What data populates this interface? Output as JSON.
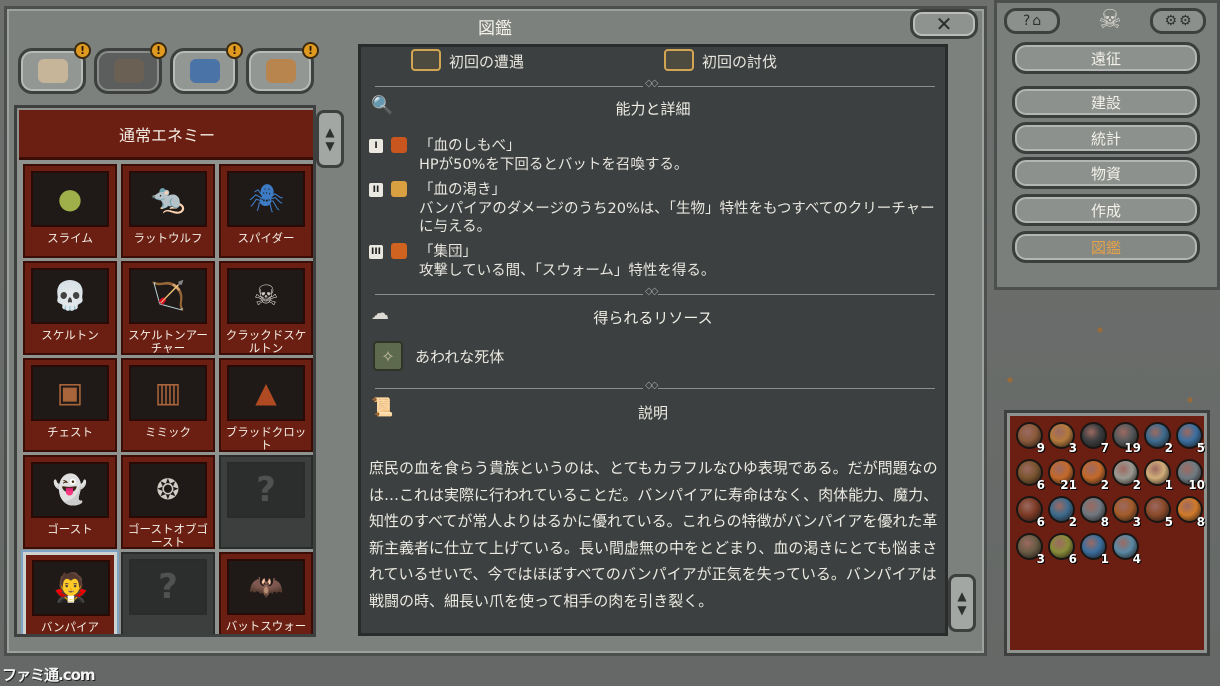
{
  "window": {
    "title": "図鑑"
  },
  "tabs": [
    {
      "name": "map",
      "alert": "!",
      "color": "#c7b59a"
    },
    {
      "name": "enemy",
      "alert": "!",
      "color": "#6b6054",
      "active": true
    },
    {
      "name": "items",
      "alert": "!",
      "color": "#4a74a8"
    },
    {
      "name": "buildings",
      "alert": "!",
      "color": "#b9854f"
    }
  ],
  "enemy_list": {
    "header": "通常エネミー",
    "enemies": [
      {
        "name": "スライム",
        "sprite": "●",
        "color": "#9fb04a"
      },
      {
        "name": "ラットウルフ",
        "sprite": "🐀",
        "color": "#a85c3a"
      },
      {
        "name": "スパイダー",
        "sprite": "🕷",
        "color": "#3d7bc4"
      },
      {
        "name": "スケルトン",
        "sprite": "💀",
        "color": "#d8d6cc"
      },
      {
        "name": "スケルトンアーチャー",
        "sprite": "🏹",
        "color": "#d8d6cc"
      },
      {
        "name": "クラックドスケルトン",
        "sprite": "☠",
        "color": "#c9c7be"
      },
      {
        "name": "チェスト",
        "sprite": "▣",
        "color": "#a8643a"
      },
      {
        "name": "ミミック",
        "sprite": "▥",
        "color": "#a8643a"
      },
      {
        "name": "ブラッドクロット",
        "sprite": "▲",
        "color": "#b04a22"
      },
      {
        "name": "ゴースト",
        "sprite": "👻",
        "color": "#e1ded6"
      },
      {
        "name": "ゴーストオブゴースト",
        "sprite": "❂",
        "color": "#cfccc3"
      },
      {
        "name": "",
        "sprite": "?",
        "color": "#4f5250",
        "unknown": true
      },
      {
        "name": "バンパイア",
        "sprite": "🧛",
        "color": "#b04a22",
        "selected": true
      },
      {
        "name": "",
        "sprite": "?",
        "color": "#4f5250",
        "unknown": true
      },
      {
        "name": "バットスウォーム",
        "sprite": "🦇",
        "color": "#d0631f"
      }
    ]
  },
  "detail": {
    "first_encounter": "初回の遭遇",
    "first_kill": "初回の討伐",
    "abilities_title": "能力と詳細",
    "abilities": [
      {
        "num": "I",
        "title": "「血のしもべ」",
        "text": "HPが50%を下回るとバットを召喚する。",
        "icon_color": "#c9561f"
      },
      {
        "num": "II",
        "title": "「血の渇き」",
        "text": "バンパイアのダメージのうち20%は、「生物」特性をもつすべてのクリーチャーに与える。",
        "icon_color": "#d8a040"
      },
      {
        "num": "III",
        "title": "「集団」",
        "text": "攻撃している間、「スウォーム」特性を得る。",
        "icon_color": "#d0631f"
      }
    ],
    "resources_title": "得られるリソース",
    "resource_name": "あわれな死体",
    "description_title": "説明",
    "description": "庶民の血を食らう貴族というのは、とてもカラフルなひゆ表現である。だが問題なのは…これは実際に行われていることだ。バンパイアに寿命はなく、肉体能力、魔力、知性のすべてが常人よりはるかに優れている。これらの特徴がバンパイアを優れた革新主義者に仕立て上げている。長い間虚無の中をとどまり、血の渇きにとても悩まされているせいで、今ではほぼすべてのバンパイアが正気を失っている。バンパイアは戦闘の時、細長い爪を使って相手の肉を引き裂く。"
  },
  "menu": {
    "items": [
      "遠征",
      "建設",
      "統計",
      "物資",
      "作成",
      "図鑑"
    ],
    "current": "図鑑"
  },
  "inventory": [
    {
      "count": "9",
      "color": "#8a5a3a"
    },
    {
      "count": "3",
      "color": "#b57a3c"
    },
    {
      "count": "7",
      "color": "#3a3d3f"
    },
    {
      "count": "19",
      "color": "#55595b"
    },
    {
      "count": "2",
      "color": "#3d6c8f"
    },
    {
      "count": "5",
      "color": "#3a6fa0"
    },
    {
      "count": "6",
      "color": "#7a5530"
    },
    {
      "count": "21",
      "color": "#c4692a"
    },
    {
      "count": "2",
      "color": "#c4692a"
    },
    {
      "count": "2",
      "color": "#9a9a92"
    },
    {
      "count": "1",
      "color": "#d1ae7a"
    },
    {
      "count": "10",
      "color": "#6f7b83"
    },
    {
      "count": "6",
      "color": "#7c3b25"
    },
    {
      "count": "2",
      "color": "#3d6c8f"
    },
    {
      "count": "8",
      "color": "#6f7780"
    },
    {
      "count": "3",
      "color": "#a35c2a"
    },
    {
      "count": "5",
      "color": "#8a4a2a"
    },
    {
      "count": "8",
      "color": "#d07a2a"
    },
    {
      "count": "3",
      "color": "#6a5c44"
    },
    {
      "count": "6",
      "color": "#8a8d3a"
    },
    {
      "count": "1",
      "color": "#3a6fa0"
    },
    {
      "count": "4",
      "color": "#5a8aa6"
    }
  ],
  "watermark": "ファミ通.com"
}
